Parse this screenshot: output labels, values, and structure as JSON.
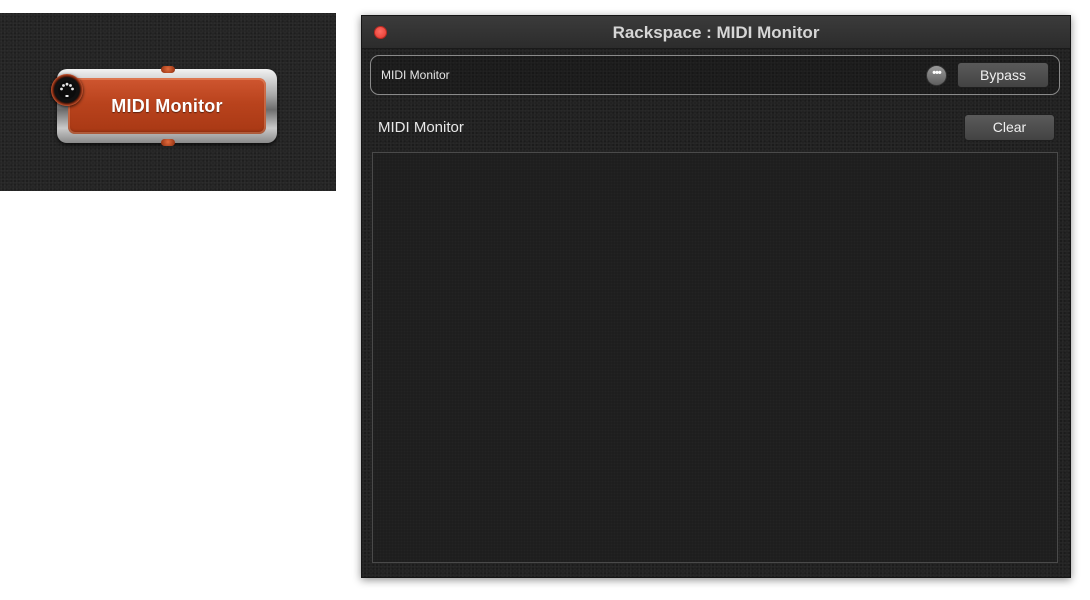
{
  "rack_block": {
    "label": "MIDI Monitor",
    "face_color": "#b9431d"
  },
  "window": {
    "title": "Rackspace : MIDI Monitor",
    "close_color": "#ff5f57"
  },
  "plugin_header": {
    "name": "MIDI Monitor",
    "more_label": "•••",
    "bypass_label": "Bypass"
  },
  "monitor": {
    "title": "MIDI Monitor",
    "clear_label": "Clear",
    "log_entries": []
  }
}
